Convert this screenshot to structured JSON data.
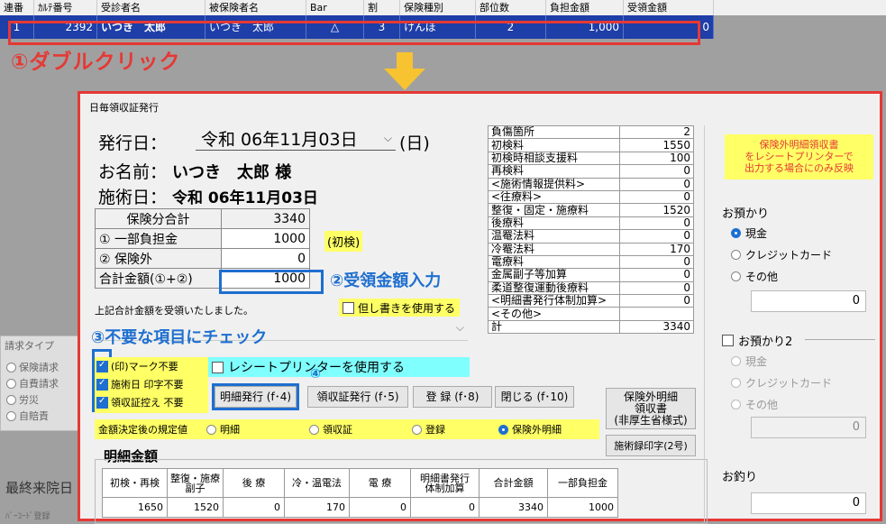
{
  "list": {
    "columns": [
      "連番",
      "ｶﾙﾃ番号",
      "受診者名",
      "被保険者名",
      "Bar",
      "割",
      "保険種別",
      "部位数",
      "負担金額",
      "受領金額"
    ],
    "row": [
      "1",
      "2392",
      "いつき　太郎",
      "いつき　太郎",
      "△",
      "3",
      "けんぽ",
      "2",
      "1,000",
      "0"
    ]
  },
  "annotations": {
    "a1": "①ダブルクリック",
    "a2": "②受領金額入力",
    "a3": "③不要な項目にチェック",
    "a4": "④"
  },
  "background": {
    "claim_title": "請求タイプ",
    "claim_options": [
      "保険請求",
      "自費請求",
      "労災",
      "自賠責"
    ],
    "last_visit": "最終来院日",
    "barcode": "ﾊﾞｰｺｰﾄﾞ登録"
  },
  "dialog": {
    "title": "日毎領収証発行",
    "issue_date_label": "発行日：",
    "issue_date_value": "令和 06年11月03日",
    "issue_weekday": "(日)",
    "name_label": "お名前：",
    "name_value": "いつき　太郎 様",
    "treat_date_label": "施術日：",
    "treat_date_value": "令和 06年11月03日",
    "summary": {
      "ins_total_label": "保険分合計",
      "ins_total": "3340",
      "part_label": "① 一部負担金",
      "part_value": "1000",
      "part_note": "(初検)",
      "nonins_label": "② 保険外",
      "nonins_value": "0",
      "total_label": "合計金額(①+②)",
      "total_value": "1000"
    },
    "received_text": "上記合計金額を受領いたしました。",
    "proviso_label": "但し書きを使用する",
    "checks": [
      {
        "label": "(印)マーク不要",
        "checked": true
      },
      {
        "label": "施術日 印字不要",
        "checked": true
      },
      {
        "label": "領収証控え 不要",
        "checked": true
      }
    ],
    "receipt_printer_label": "レシートプリンターを使用する",
    "buttons": {
      "detail": "明細発行 (f･4)",
      "receipt": "領収証発行 (f･5)",
      "register": "登 録 (f･8)",
      "close": "閉じる (f･10)",
      "noninsurance": "保険外明細\n領収書\n(非厚生省様式)",
      "treat_record": "施術録印字(2号)"
    },
    "default_label": "金額決定後の規定値",
    "default_options": [
      "明細",
      "領収証",
      "登録",
      "保険外明細"
    ],
    "default_selected": "保険外明細",
    "detail_title": "明細金額",
    "grid_headers": [
      "初検・再検",
      "整復・施療\n副子",
      "後 療",
      "冷・温電法",
      "電 療",
      "明細書発行\n体制加算",
      "合計金額",
      "一部負担金"
    ],
    "grid_values": [
      "1650",
      "1520",
      "0",
      "170",
      "0",
      "0",
      "3340",
      "1000"
    ],
    "fees": [
      [
        "負傷箇所",
        "2"
      ],
      [
        "初検料",
        "1550"
      ],
      [
        "初検時相談支援料",
        "100"
      ],
      [
        "再検料",
        "0"
      ],
      [
        "<施術情報提供料>",
        "0"
      ],
      [
        "<往療料>",
        "0"
      ],
      [
        "整復・固定・施療料",
        "1520"
      ],
      [
        "後療料",
        "0"
      ],
      [
        "温罨法料",
        "0"
      ],
      [
        "冷罨法料",
        "170"
      ],
      [
        "電療料",
        "0"
      ],
      [
        "金属副子等加算",
        "0"
      ],
      [
        "柔道整復運動後療料",
        "0"
      ],
      [
        "<明細書発行体制加算>",
        "0"
      ],
      [
        "<その他>",
        ""
      ],
      [
        "計",
        "3340"
      ]
    ],
    "right": {
      "notice": "保険外明細領収書\nをレシートプリンターで\n出力する場合にのみ反映",
      "deposit_label": "お預かり",
      "deposit_options": [
        "現金",
        "クレジットカード",
        "その他"
      ],
      "deposit_value": "0",
      "deposit2_label": "お預かり2",
      "deposit2_options": [
        "現金",
        "クレジットカード",
        "その他"
      ],
      "deposit2_value": "0",
      "change_label": "お釣り",
      "change_value": "0"
    }
  }
}
